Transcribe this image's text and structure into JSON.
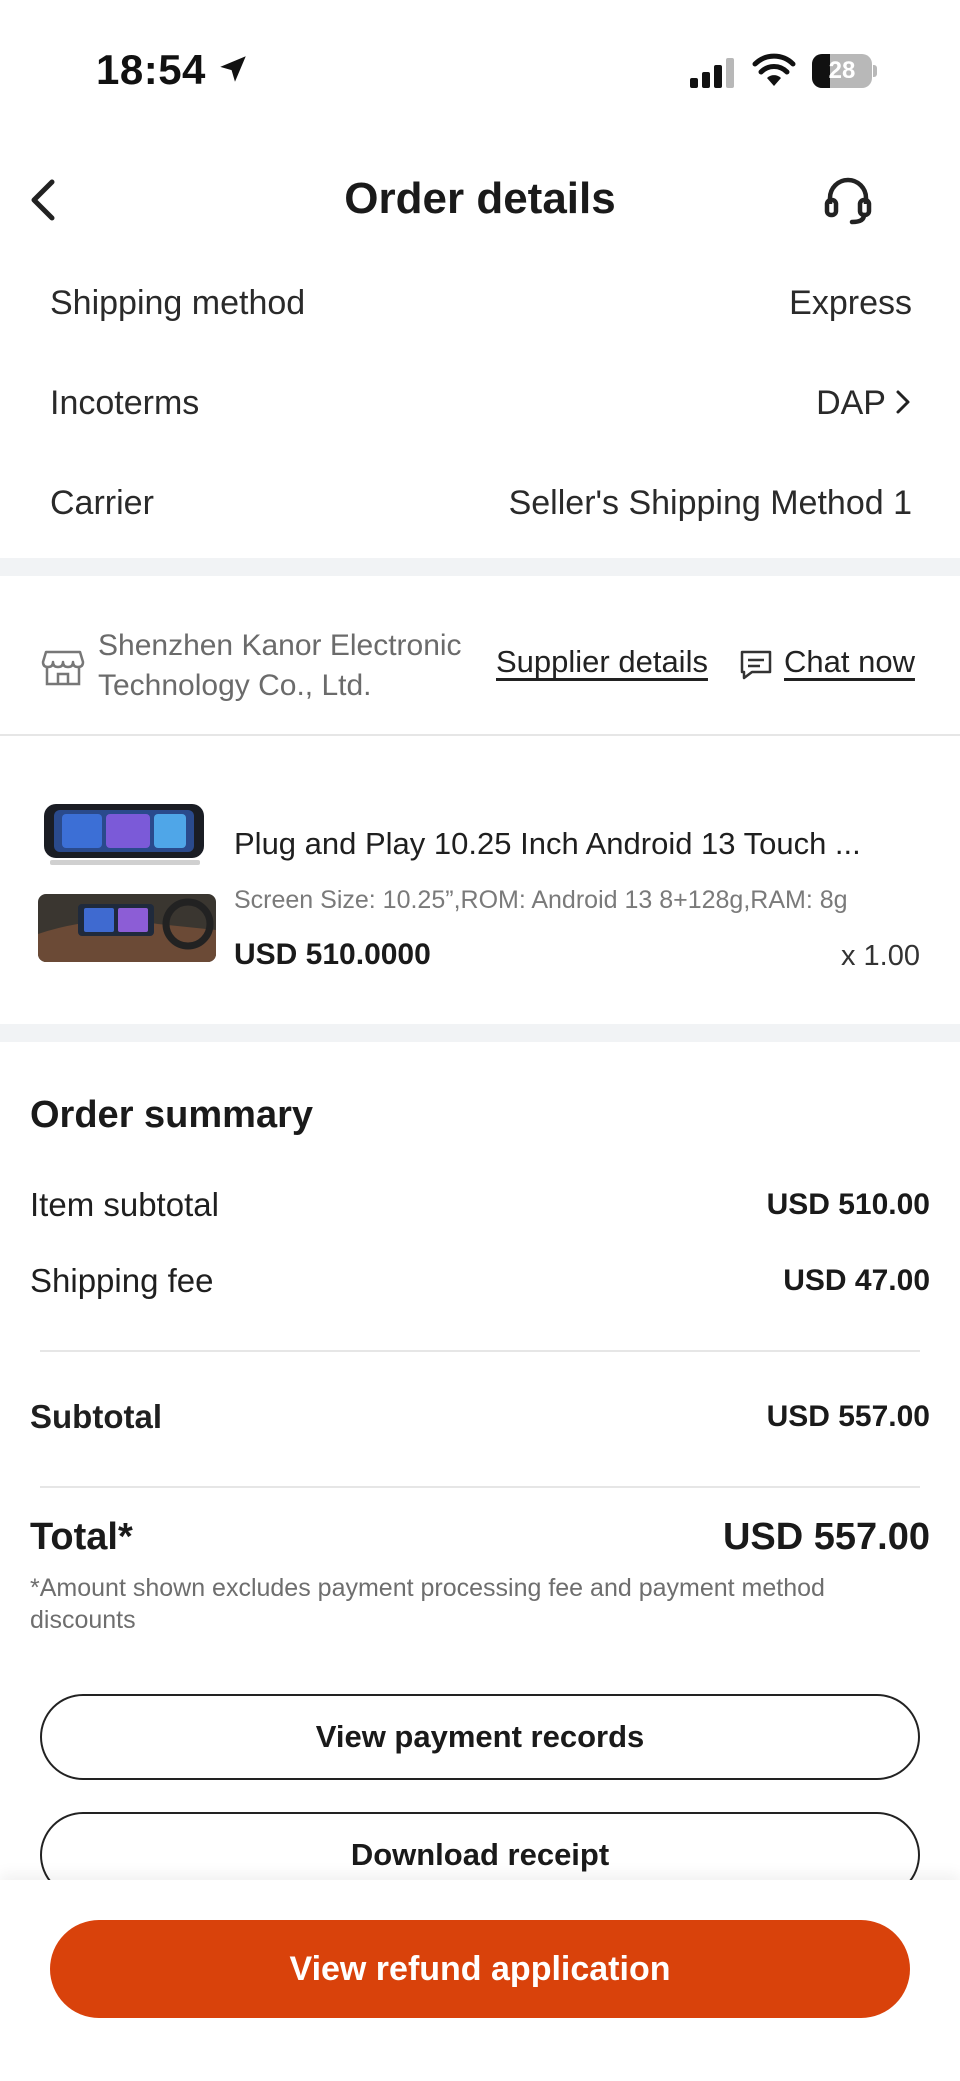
{
  "status_bar": {
    "time": "18:54",
    "battery": "28"
  },
  "header": {
    "title": "Order details"
  },
  "shipping": {
    "rows": [
      {
        "label": "Shipping method",
        "value": "Express"
      },
      {
        "label": "Incoterms",
        "value": "DAP"
      },
      {
        "label": "Carrier",
        "value": "Seller's Shipping Method 1"
      }
    ]
  },
  "supplier": {
    "name": "Shenzhen Kanor Electronic Technology Co., Ltd.",
    "details_link": "Supplier details",
    "chat_link": "Chat now"
  },
  "product": {
    "title": "Plug and Play 10.25 Inch Android 13 Touch ...",
    "spec": "Screen Size: 10.25”,ROM: Android 13 8+128g,RAM: 8g",
    "price": "USD 510.0000",
    "quantity": "x 1.00"
  },
  "summary": {
    "title": "Order summary",
    "item_subtotal_label": "Item subtotal",
    "item_subtotal_value": "USD 510.00",
    "shipping_fee_label": "Shipping fee",
    "shipping_fee_value": "USD 47.00",
    "subtotal_label": "Subtotal",
    "subtotal_value": "USD 557.00",
    "total_label": "Total*",
    "total_value": "USD 557.00",
    "footnote": "*Amount shown excludes payment processing fee and payment method discounts"
  },
  "buttons": {
    "view_payment_records": "View payment records",
    "download_receipt": "Download receipt",
    "view_refund_application": "View refund application"
  },
  "colors": {
    "primary": "#d9420b",
    "separator": "#f1f3f5"
  }
}
